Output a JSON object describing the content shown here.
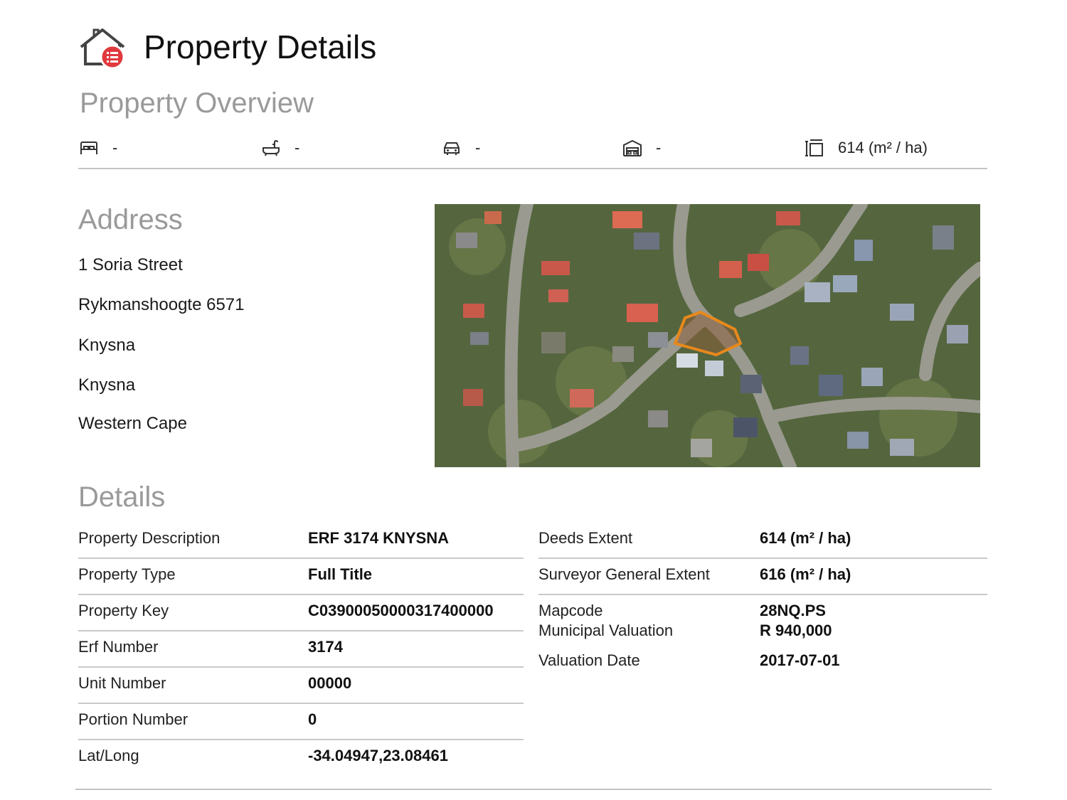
{
  "header": {
    "title": "Property Details",
    "logo_icon": "house-list-icon"
  },
  "overview": {
    "heading": "Property Overview",
    "stats": [
      {
        "icon": "bed-icon",
        "value": "-"
      },
      {
        "icon": "bath-icon",
        "value": "-"
      },
      {
        "icon": "car-icon",
        "value": "-"
      },
      {
        "icon": "garage-icon",
        "value": "-"
      },
      {
        "icon": "floor-area-icon",
        "value": "614 (m² / ha)"
      }
    ]
  },
  "address": {
    "heading": "Address",
    "lines": [
      "1 Soria Street",
      "Rykmanshoogte 6571",
      "Knysna",
      "Knysna",
      "Western Cape"
    ]
  },
  "map": {
    "boundary_color": "#e8891c"
  },
  "details": {
    "heading": "Details",
    "left": [
      {
        "label": "Property Description",
        "value": "ERF 3174 KNYSNA"
      },
      {
        "label": "Property Type",
        "value": "Full Title"
      },
      {
        "label": "Property Key",
        "value": "C03900050000317400000"
      },
      {
        "label": "Erf Number",
        "value": "3174"
      },
      {
        "label": "Unit Number",
        "value": "00000"
      },
      {
        "label": "Portion Number",
        "value": "0"
      },
      {
        "label": "Lat/Long",
        "value": "-34.04947,23.08461"
      }
    ],
    "right": [
      {
        "label": "Deeds Extent",
        "value": "614 (m² / ha)"
      },
      {
        "label": "Surveyor General Extent",
        "value": "616 (m² / ha)"
      },
      {
        "label": "Mapcode",
        "value": "28NQ.PS"
      },
      {
        "label": "Municipal Valuation",
        "value": "R 940,000"
      },
      {
        "label": "Valuation Date",
        "value": "2017-07-01"
      }
    ]
  },
  "colors": {
    "accent": "#e03a3e",
    "heading_gray": "#9a9a9a",
    "rule": "#c4c4c4"
  }
}
